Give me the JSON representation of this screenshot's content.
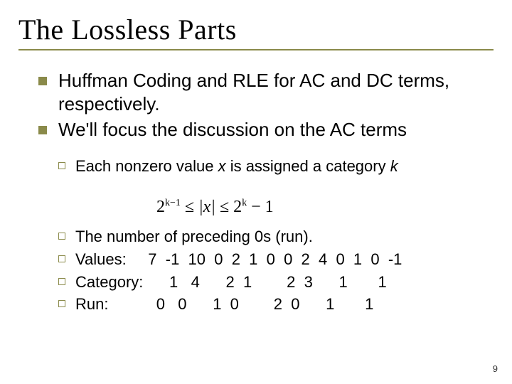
{
  "title": "The Lossless Parts",
  "bullets_l1": [
    "Huffman Coding and RLE for AC and DC terms, respectively.",
    "We'll focus the discussion on the AC terms"
  ],
  "bullets_l2": {
    "item0_pre": "Each nonzero value ",
    "item0_x": "x",
    "item0_mid": " is assigned a category ",
    "item0_k": "k",
    "item1": "The number of preceding 0s (run).",
    "row_values": "Values:     7  -1  10  0  2  1  0  0  2  4  0  1  0  -1",
    "row_category": "Category:      1   4      2  1        2  3      1       1",
    "row_run": "Run:           0   0      1  0        2  0      1       1"
  },
  "formula": {
    "lhs_base": "2",
    "lhs_exp": "k−1",
    "leq1": " ≤ ",
    "mid": "|x|",
    "leq2": " ≤ ",
    "rhs_base": "2",
    "rhs_exp": "k",
    "rhs_tail": " − 1"
  },
  "page_number": "9"
}
